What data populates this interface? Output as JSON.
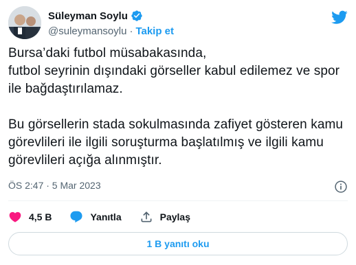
{
  "header": {
    "display_name": "Süleyman Soylu",
    "handle": "@suleymansoylu",
    "separator": "·",
    "follow_label": "Takip et"
  },
  "tweet": {
    "paragraphs": [
      "Bursa’daki futbol müsabakasında,\nfutbol seyrinin dışındaki görseller kabul edilemez ve spor ile bağdaştırılamaz.",
      "Bu görsellerin stada sokulmasında zafiyet gösteren kamu görevlileri ile ilgili soruşturma başlatılmış ve ilgili kamu görevlileri açığa alınmıştır."
    ],
    "timestamp": "ÖS 2:47 · 5 Mar 2023"
  },
  "actions": {
    "like_count": "4,5 B",
    "reply_label": "Yanıtla",
    "share_label": "Paylaş"
  },
  "replies_button": "1 B yanıtı oku",
  "icons": {
    "verified": "verified-badge-icon",
    "logo": "twitter-bird-icon",
    "info": "info-icon",
    "like": "heart-icon",
    "reply": "speech-bubble-icon",
    "share": "share-upload-icon"
  },
  "colors": {
    "accent": "#1d9bf0",
    "like": "#f91880",
    "muted": "#536471",
    "text": "#0f1419"
  }
}
